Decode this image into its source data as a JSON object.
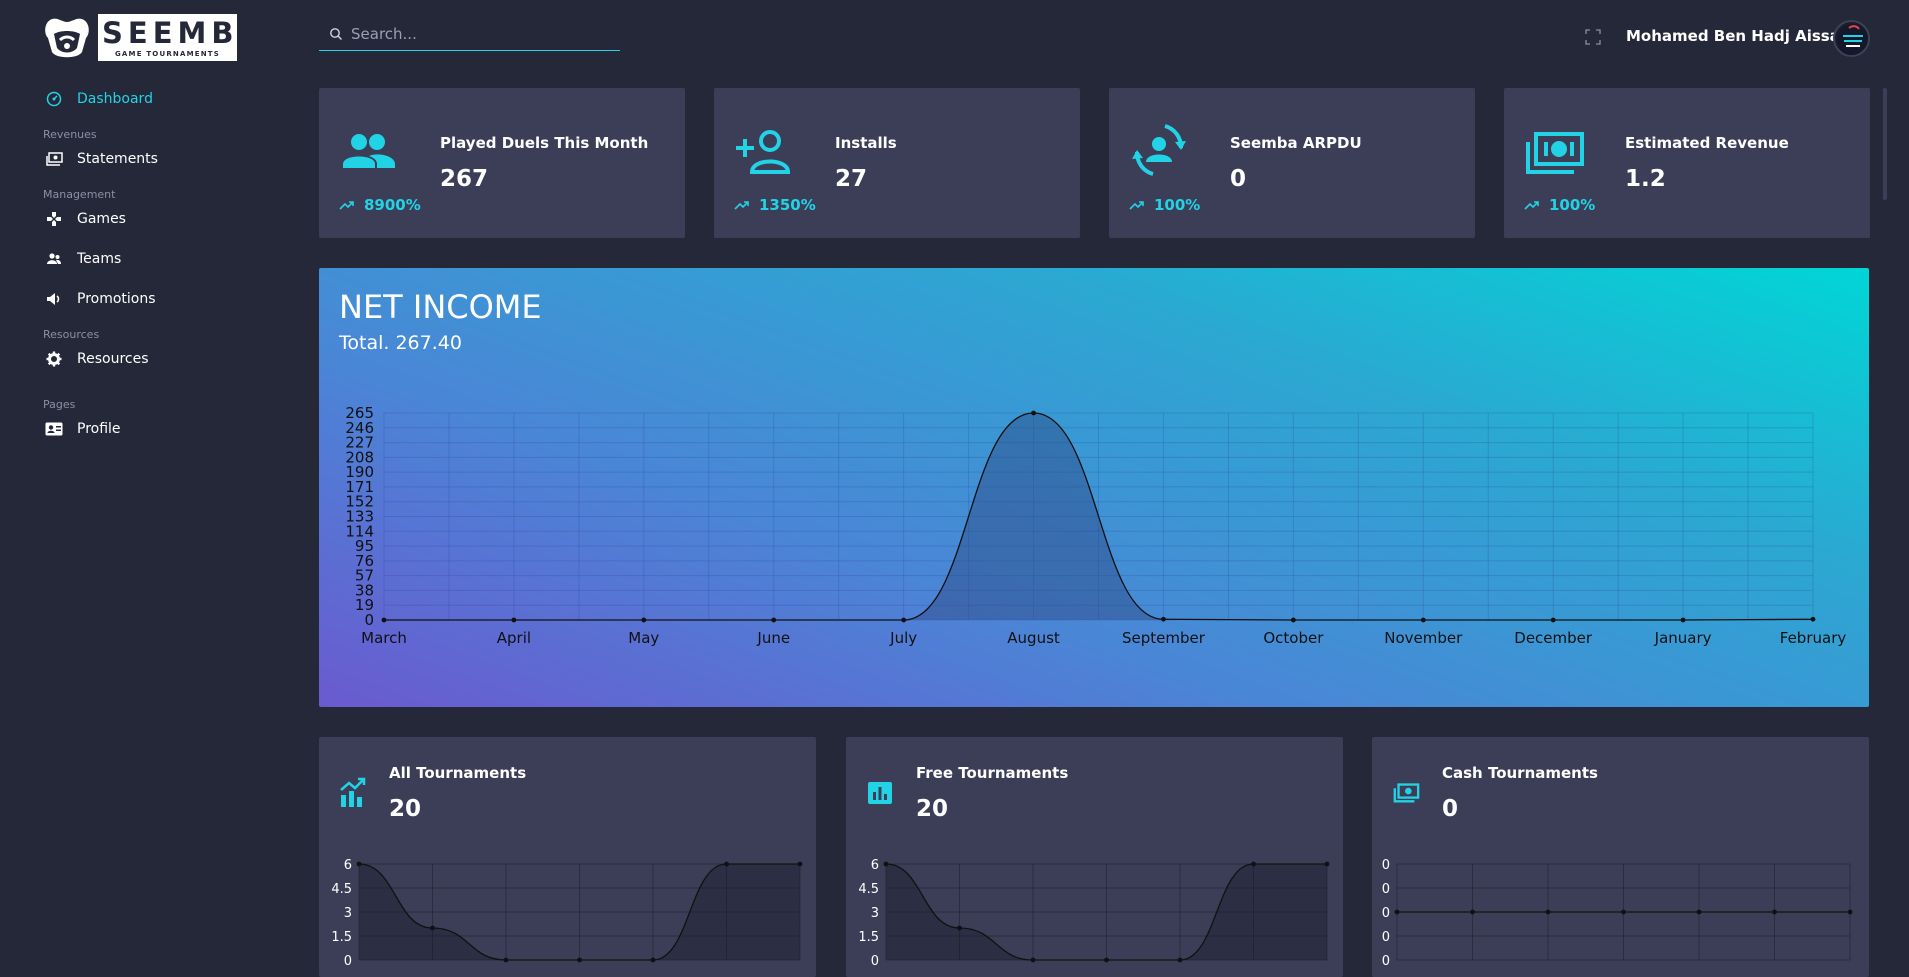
{
  "brand": {
    "name": "SEEMBA",
    "tagline": "GAME TOURNAMENTS SYSTEM"
  },
  "sidebar": {
    "items": [
      {
        "type": "item",
        "label": "Dashboard",
        "icon": "dashboard-icon",
        "active": true
      },
      {
        "type": "section",
        "label": "Revenues"
      },
      {
        "type": "item",
        "label": "Statements",
        "icon": "money-icon"
      },
      {
        "type": "section",
        "label": "Management"
      },
      {
        "type": "item",
        "label": "Games",
        "icon": "gamepad-icon"
      },
      {
        "type": "item",
        "label": "Teams",
        "icon": "teams-icon"
      },
      {
        "type": "item",
        "label": "Promotions",
        "icon": "megaphone-icon"
      },
      {
        "type": "section",
        "label": "Resources"
      },
      {
        "type": "item",
        "label": "Resources",
        "icon": "gear-icon"
      },
      {
        "type": "section",
        "label": "Pages"
      },
      {
        "type": "item",
        "label": "Profile",
        "icon": "profile-card-icon"
      }
    ]
  },
  "header": {
    "search_placeholder": "Search...",
    "user_name": "Mohamed Ben Hadj Aissa"
  },
  "stats": [
    {
      "label": "Played Duels This Month",
      "value": "267",
      "trend": "8900%",
      "icon": "users-group-icon"
    },
    {
      "label": "Installs",
      "value": "27",
      "trend": "1350%",
      "icon": "add-user-icon"
    },
    {
      "label": "Seemba ARPDU",
      "value": "0",
      "trend": "100%",
      "icon": "user-cycle-icon"
    },
    {
      "label": "Estimated Revenue",
      "value": "1.2",
      "trend": "100%",
      "icon": "money-stack-icon"
    }
  ],
  "net_income": {
    "title": "NET INCOME",
    "total": "Total. 267.40"
  },
  "chart_data": [
    {
      "type": "area",
      "categories": [
        "March",
        "April",
        "May",
        "June",
        "July",
        "August",
        "September",
        "October",
        "November",
        "December",
        "January",
        "February"
      ],
      "values": [
        0,
        0,
        0,
        0,
        0,
        265,
        1,
        0,
        0,
        0,
        0,
        1
      ],
      "yticks": [
        "0",
        "19",
        "38",
        "57",
        "76",
        "95",
        "114",
        "133",
        "152",
        "171",
        "190",
        "208",
        "227",
        "246",
        "265"
      ],
      "ylim": [
        0,
        265
      ],
      "grid": true
    },
    {
      "type": "area",
      "values": [
        6,
        2,
        0,
        0,
        0,
        6,
        6
      ],
      "yticks": [
        "0",
        "1.5",
        "3",
        "4.5",
        "6"
      ],
      "ylim": [
        0,
        6
      ],
      "grid": true
    },
    {
      "type": "area",
      "values": [
        6,
        2,
        0,
        0,
        0,
        6,
        6
      ],
      "yticks": [
        "0",
        "1.5",
        "3",
        "4.5",
        "6"
      ],
      "ylim": [
        0,
        6
      ],
      "grid": true
    },
    {
      "type": "line",
      "values": [
        0,
        0,
        0,
        0,
        0,
        0,
        0
      ],
      "yticks": [
        "0",
        "0",
        "0",
        "0",
        "0"
      ],
      "ylim": [
        -1,
        1
      ],
      "grid": true
    }
  ],
  "tournaments": [
    {
      "label": "All Tournaments",
      "value": "20",
      "icon": "chart-growth-icon"
    },
    {
      "label": "Free Tournaments",
      "value": "20",
      "icon": "bar-chart-icon"
    },
    {
      "label": "Cash Tournaments",
      "value": "0",
      "icon": "money-stack-icon"
    }
  ],
  "colors": {
    "accent": "#22d3e6",
    "card": "#3c3e58",
    "background": "#252838"
  }
}
